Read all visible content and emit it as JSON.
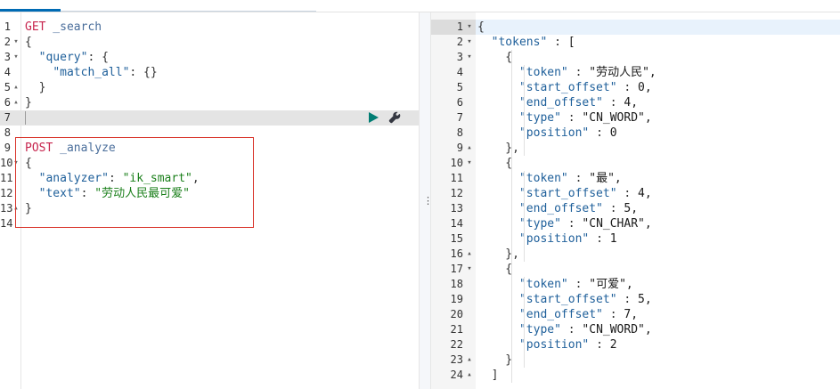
{
  "editor": {
    "lines": [
      {
        "n": "1",
        "fold": "",
        "parts": [
          [
            "m",
            "GET"
          ],
          [
            "p",
            " _search"
          ]
        ]
      },
      {
        "n": "2",
        "fold": "▾",
        "parts": [
          [
            "t",
            "{"
          ]
        ]
      },
      {
        "n": "3",
        "fold": "▾",
        "parts": [
          [
            "t",
            "  "
          ],
          [
            "k",
            "\"query\""
          ],
          [
            "t",
            ": {"
          ]
        ]
      },
      {
        "n": "4",
        "fold": "",
        "parts": [
          [
            "t",
            "    "
          ],
          [
            "k",
            "\"match_all\""
          ],
          [
            "t",
            ": {}"
          ]
        ]
      },
      {
        "n": "5",
        "fold": "▴",
        "parts": [
          [
            "t",
            "  }"
          ]
        ]
      },
      {
        "n": "6",
        "fold": "▴",
        "parts": [
          [
            "t",
            "}"
          ]
        ]
      },
      {
        "n": "7",
        "fold": "",
        "parts": [],
        "active": true
      },
      {
        "n": "8",
        "fold": "",
        "parts": []
      },
      {
        "n": "9",
        "fold": "",
        "parts": [
          [
            "m",
            "POST"
          ],
          [
            "p",
            " _analyze"
          ]
        ]
      },
      {
        "n": "10",
        "fold": "▾",
        "parts": [
          [
            "t",
            "{"
          ]
        ]
      },
      {
        "n": "11",
        "fold": "",
        "parts": [
          [
            "t",
            "  "
          ],
          [
            "k",
            "\"analyzer\""
          ],
          [
            "t",
            ": "
          ],
          [
            "d",
            "\"ik_smart\""
          ],
          [
            "t",
            ","
          ]
        ]
      },
      {
        "n": "12",
        "fold": "",
        "parts": [
          [
            "t",
            "  "
          ],
          [
            "k",
            "\"text\""
          ],
          [
            "t",
            ": "
          ],
          [
            "d",
            "\"劳动人民最可爱\""
          ]
        ]
      },
      {
        "n": "13",
        "fold": "▴",
        "parts": [
          [
            "t",
            "}"
          ]
        ]
      },
      {
        "n": "14",
        "fold": "",
        "parts": []
      }
    ]
  },
  "response": {
    "lines": [
      {
        "n": "1",
        "fold": "▾",
        "text": "{",
        "active": true
      },
      {
        "n": "2",
        "fold": "▾",
        "text": "  \"tokens\" : ["
      },
      {
        "n": "3",
        "fold": "▾",
        "text": "    {"
      },
      {
        "n": "4",
        "fold": "",
        "text": "      \"token\" : \"劳动人民\","
      },
      {
        "n": "5",
        "fold": "",
        "text": "      \"start_offset\" : 0,"
      },
      {
        "n": "6",
        "fold": "",
        "text": "      \"end_offset\" : 4,"
      },
      {
        "n": "7",
        "fold": "",
        "text": "      \"type\" : \"CN_WORD\","
      },
      {
        "n": "8",
        "fold": "",
        "text": "      \"position\" : 0"
      },
      {
        "n": "9",
        "fold": "▴",
        "text": "    },"
      },
      {
        "n": "10",
        "fold": "▾",
        "text": "    {"
      },
      {
        "n": "11",
        "fold": "",
        "text": "      \"token\" : \"最\","
      },
      {
        "n": "12",
        "fold": "",
        "text": "      \"start_offset\" : 4,"
      },
      {
        "n": "13",
        "fold": "",
        "text": "      \"end_offset\" : 5,"
      },
      {
        "n": "14",
        "fold": "",
        "text": "      \"type\" : \"CN_CHAR\","
      },
      {
        "n": "15",
        "fold": "",
        "text": "      \"position\" : 1"
      },
      {
        "n": "16",
        "fold": "▴",
        "text": "    },"
      },
      {
        "n": "17",
        "fold": "▾",
        "text": "    {"
      },
      {
        "n": "18",
        "fold": "",
        "text": "      \"token\" : \"可爱\","
      },
      {
        "n": "19",
        "fold": "",
        "text": "      \"start_offset\" : 5,"
      },
      {
        "n": "20",
        "fold": "",
        "text": "      \"end_offset\" : 7,"
      },
      {
        "n": "21",
        "fold": "",
        "text": "      \"type\" : \"CN_WORD\","
      },
      {
        "n": "22",
        "fold": "",
        "text": "      \"position\" : 2"
      },
      {
        "n": "23",
        "fold": "▴",
        "text": "    }"
      },
      {
        "n": "24",
        "fold": "▴",
        "text": "  ]"
      }
    ]
  },
  "toolbar": {
    "run_icon": "play-icon",
    "settings_icon": "wrench-icon"
  },
  "colors": {
    "method": "#c7254e",
    "string": "#1a7f1a",
    "key": "#1e5f9a",
    "accent": "#006bb4",
    "run": "#017d73",
    "highlight": "#d9342b"
  }
}
